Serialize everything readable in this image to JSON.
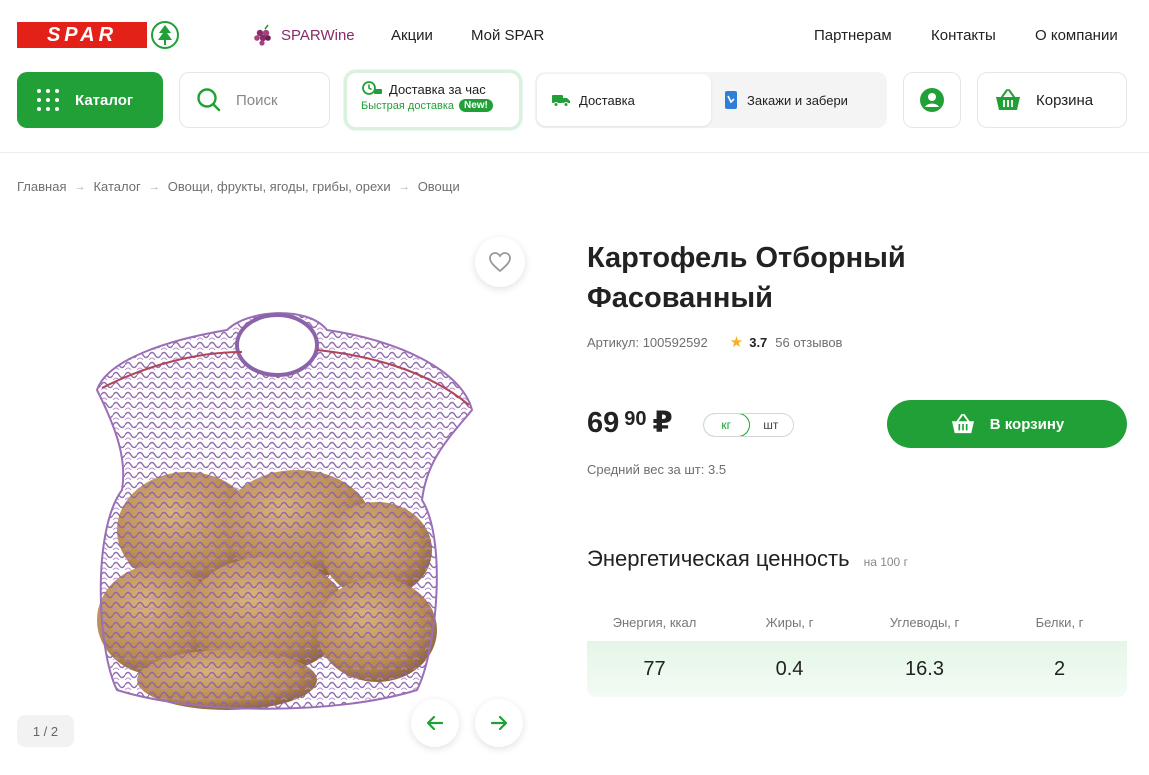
{
  "header": {
    "logo_text": "SPAR",
    "sparwine": "SPARWine",
    "links_left": [
      "Акции",
      "Мой SPAR"
    ],
    "links_right": [
      "Партнерам",
      "Контакты",
      "О компании"
    ]
  },
  "nav": {
    "catalog": "Каталог",
    "search_placeholder": "Поиск",
    "fast_delivery_title": "Доставка за час",
    "fast_delivery_sub": "Быстрая доставка",
    "badge_new": "New!",
    "delivery": "Доставка",
    "pickup": "Закажи и забери",
    "cart": "Корзина"
  },
  "breadcrumb": [
    "Главная",
    "Каталог",
    "Овощи, фрукты, ягоды, грибы, орехи",
    "Овощи"
  ],
  "gallery": {
    "counter": "1 / 2"
  },
  "product": {
    "title": "Картофель Отборный Фасованный",
    "sku_label": "Артикул: 100592592",
    "rating": "3.7",
    "reviews": "56 отзывов",
    "price_int": "69",
    "price_frac": "90",
    "currency": "₽",
    "units": [
      "кг",
      "шт"
    ],
    "active_unit": "кг",
    "avg_weight": "Средний вес за шт: 3.5",
    "add_to_cart": "В корзину"
  },
  "nutrition": {
    "title": "Энергетическая ценность",
    "per": "на 100 г",
    "headers": [
      "Энергия, ккал",
      "Жиры, г",
      "Углеводы, г",
      "Белки, г"
    ],
    "values": [
      "77",
      "0.4",
      "16.3",
      "2"
    ]
  },
  "colors": {
    "brand_green": "#21a038",
    "brand_red": "#e32119",
    "wine": "#8a2b6a"
  }
}
